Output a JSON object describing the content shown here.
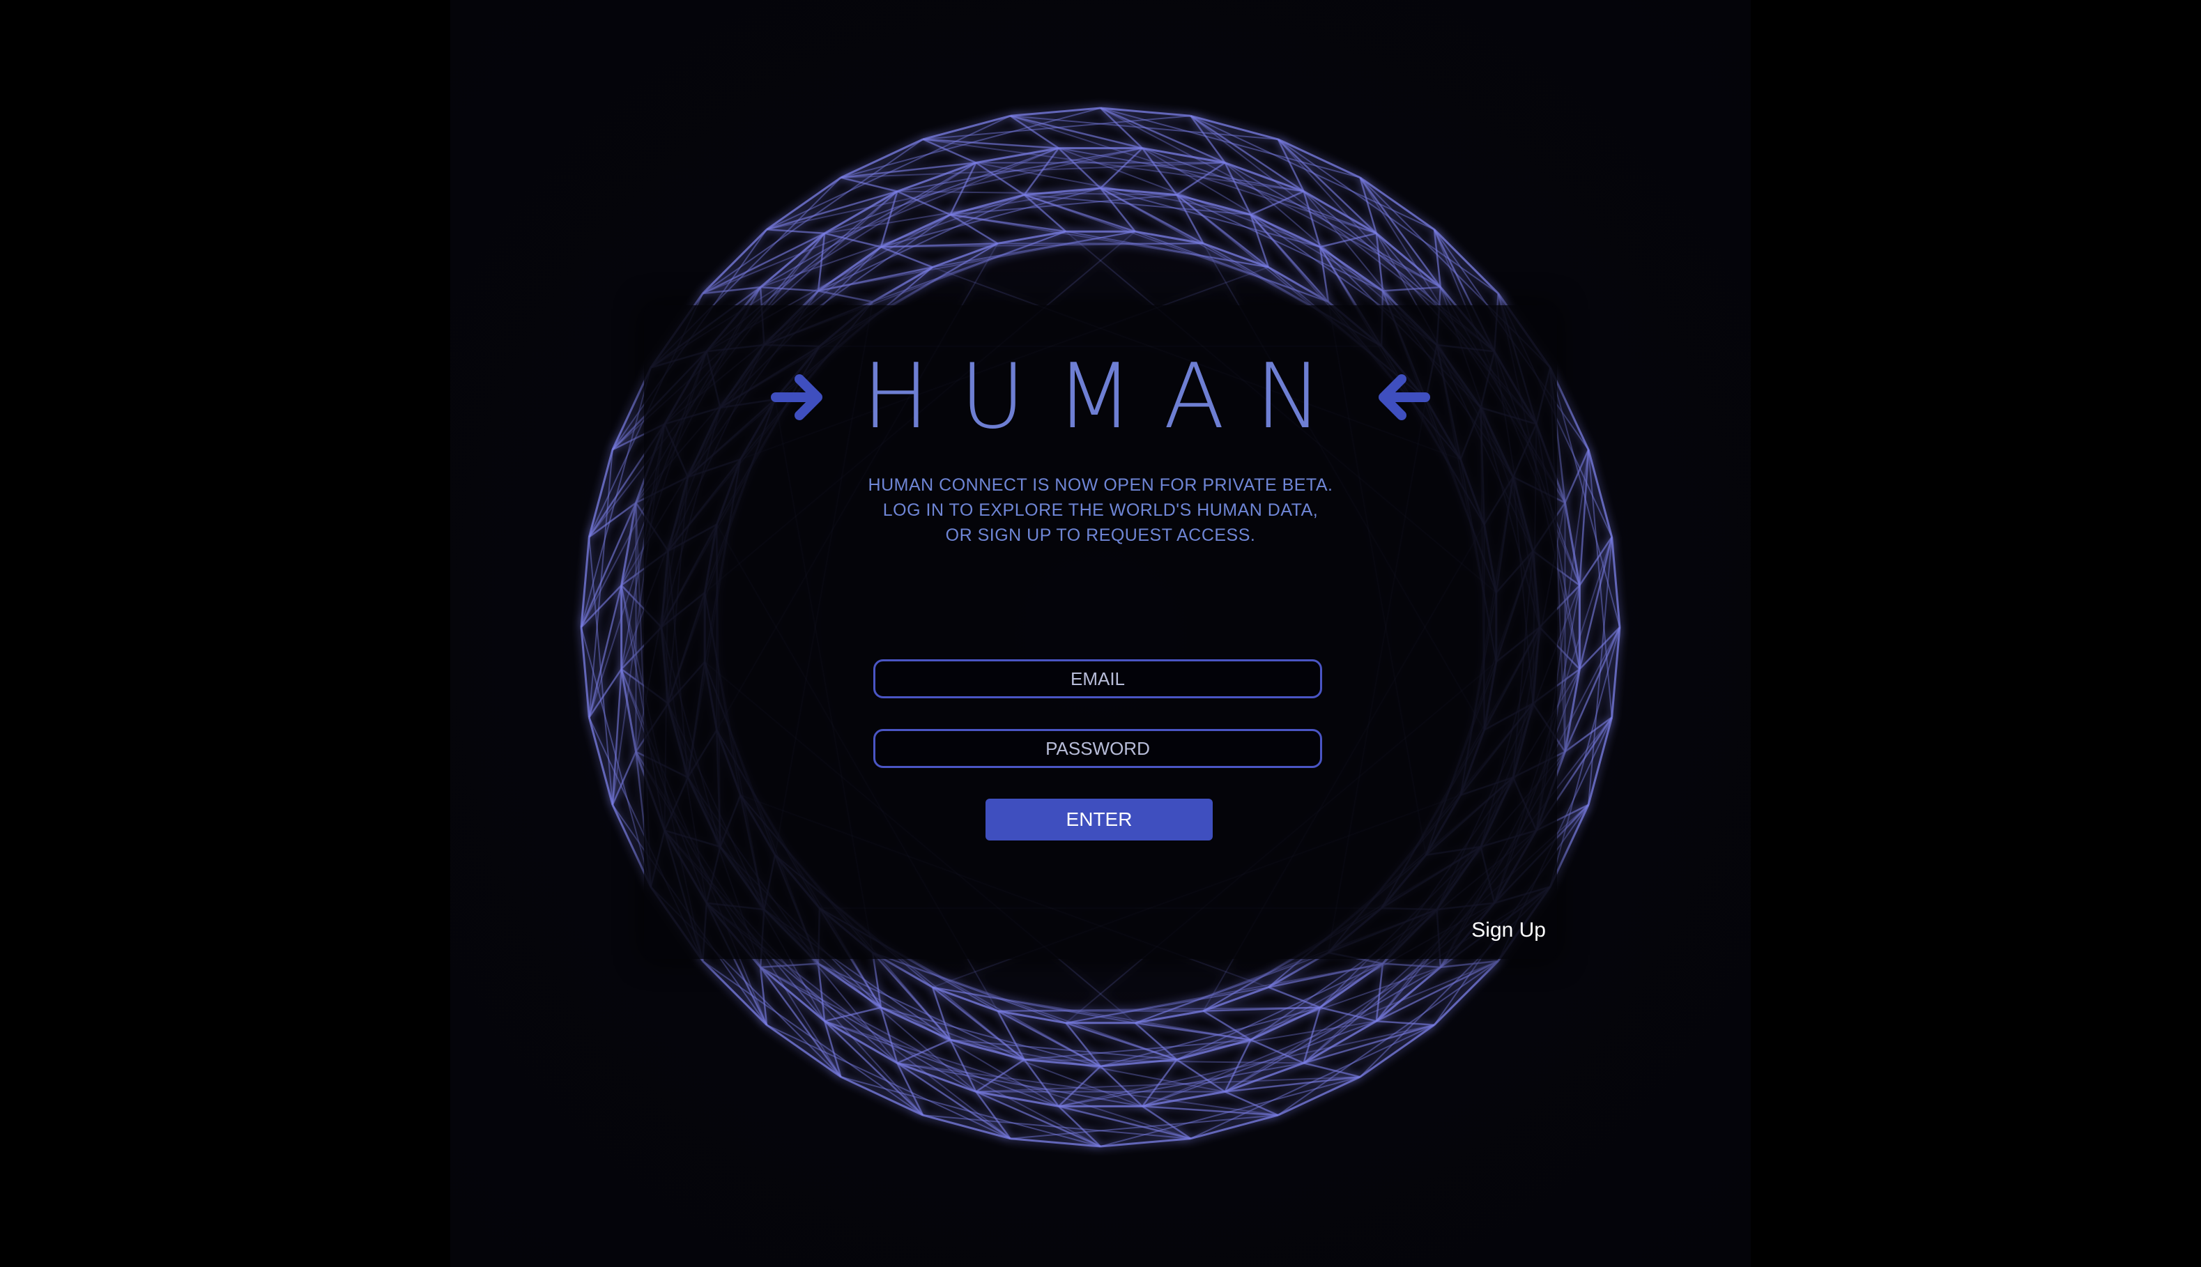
{
  "brand": {
    "name": "HUMAN",
    "accent_color": "#6e7fd3",
    "arrow_color": "#3f4fbf",
    "left_icon": "arrow-right-icon",
    "right_icon": "arrow-left-icon"
  },
  "tagline": {
    "line1": "HUMAN CONNECT IS NOW OPEN FOR PRIVATE BETA.",
    "line2": "LOG IN TO EXPLORE THE WORLD'S HUMAN DATA,",
    "line3": "OR SIGN UP TO REQUEST ACCESS."
  },
  "login": {
    "email_placeholder": "EMAIL",
    "password_placeholder": "PASSWORD",
    "enter_label": "ENTER"
  },
  "signup_label": "Sign Up",
  "background": {
    "mesh_color": "#7b7fe6",
    "mesh_glow": "#4b3fbf"
  }
}
